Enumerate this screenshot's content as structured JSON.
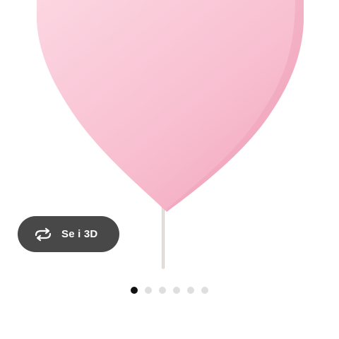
{
  "product_image": {
    "name": "heart-wall-lamp-image",
    "colors": {
      "heart_light": "#fbd0de",
      "heart_dark": "#f2a6be",
      "stem": "#d9d5cf"
    }
  },
  "view_3d": {
    "icon": "rotate-3d-icon",
    "label": "Se i 3D"
  },
  "carousel": {
    "active_index": 0,
    "dot_count": 6
  },
  "colors": {
    "button_bg": "#484848",
    "dot_active": "#111111",
    "dot_inactive": "#dfdfdf"
  }
}
